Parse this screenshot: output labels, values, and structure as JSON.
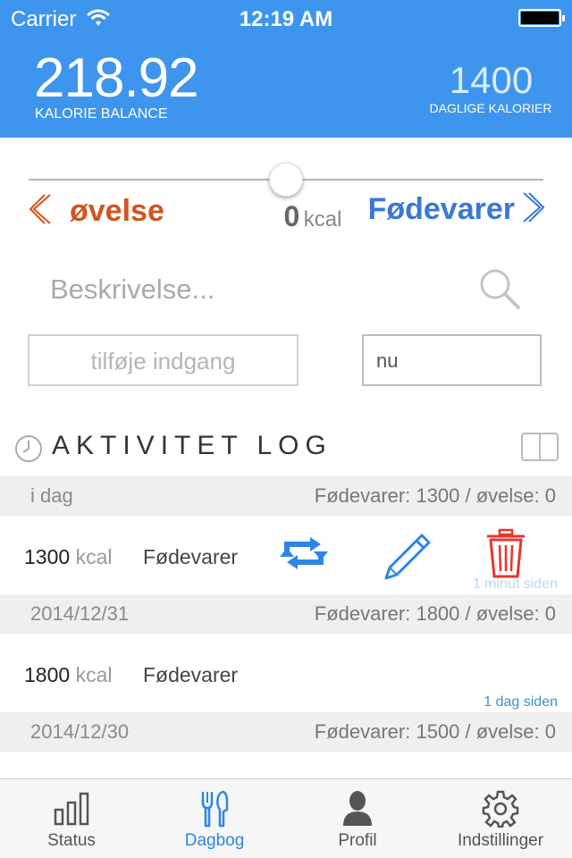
{
  "status_bar": {
    "carrier": "Carrier",
    "time": "12:19 AM"
  },
  "header": {
    "balance_value": "218.92",
    "balance_label": "KALORIE BALANCE",
    "daily_value": "1400",
    "daily_label": "DAGLIGE KALORIER"
  },
  "selector": {
    "exercise_label": "øvelse",
    "food_label": "Fødevarer",
    "kcal_value": "0",
    "kcal_unit": "kcal",
    "slider_level": 0.5
  },
  "search": {
    "placeholder": "Beskrivelse..."
  },
  "entry": {
    "add_label": "tilføje indgang",
    "time_value": "nu"
  },
  "log": {
    "title": "AKTIVITET LOG",
    "days": [
      {
        "date": "i dag",
        "summary": "Fødevarer: 1300 / øvelse: 0",
        "entry": {
          "kcal": "1300",
          "unit": "kcal",
          "type": "Fødevarer",
          "ago": "1 minut siden"
        }
      },
      {
        "date": "2014/12/31",
        "summary": "Fødevarer: 1800 / øvelse: 0",
        "entry": {
          "kcal": "1800",
          "unit": "kcal",
          "type": "Fødevarer",
          "ago": "1 dag siden"
        }
      },
      {
        "date": "2014/12/30",
        "summary": "Fødevarer: 1500 / øvelse: 0"
      }
    ]
  },
  "tabs": [
    {
      "label": "Status",
      "icon": "bar-chart-icon"
    },
    {
      "label": "Dagbog",
      "icon": "fork-knife-icon",
      "active": true
    },
    {
      "label": "Profil",
      "icon": "person-icon"
    },
    {
      "label": "Indstillinger",
      "icon": "gear-icon"
    }
  ],
  "colors": {
    "header": "#3e95ed",
    "exercise": "#d2541f",
    "food": "#3a78d4",
    "trash": "#e8342c",
    "active_tab": "#2c86e8"
  }
}
